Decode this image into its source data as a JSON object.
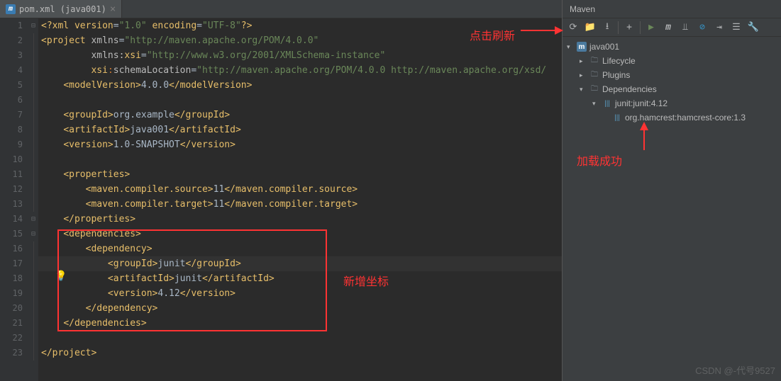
{
  "tab": {
    "icon": "m",
    "label": "pom.xml (java001)"
  },
  "gutter_lines": [
    "1",
    "2",
    "3",
    "4",
    "5",
    "6",
    "7",
    "8",
    "9",
    "10",
    "11",
    "12",
    "13",
    "14",
    "15",
    "16",
    "17",
    "18",
    "19",
    "20",
    "21",
    "22",
    "23"
  ],
  "fold_markers": {
    "1": "⊟",
    "14": "⊟",
    "15": "⊟"
  },
  "code": [
    {
      "seg": [
        {
          "c": "t-decl",
          "t": "<?"
        },
        {
          "c": "t-tag",
          "t": "xml version"
        },
        {
          "c": "t-text",
          "t": "="
        },
        {
          "c": "t-str",
          "t": "\"1.0\""
        },
        {
          "c": "t-tag",
          "t": " encoding"
        },
        {
          "c": "t-text",
          "t": "="
        },
        {
          "c": "t-str",
          "t": "\"UTF-8\""
        },
        {
          "c": "t-decl",
          "t": "?>"
        }
      ]
    },
    {
      "seg": [
        {
          "c": "t-tag",
          "t": "<project "
        },
        {
          "c": "t-attr",
          "t": "xmlns"
        },
        {
          "c": "t-text",
          "t": "="
        },
        {
          "c": "t-str",
          "t": "\"http://maven.apache.org/POM/4.0.0\""
        }
      ]
    },
    {
      "seg": [
        {
          "c": "t-text",
          "t": "         "
        },
        {
          "c": "t-attr",
          "t": "xmlns:"
        },
        {
          "c": "t-tag",
          "t": "xsi"
        },
        {
          "c": "t-text",
          "t": "="
        },
        {
          "c": "t-str",
          "t": "\"http://www.w3.org/2001/XMLSchema-instance\""
        }
      ]
    },
    {
      "seg": [
        {
          "c": "t-text",
          "t": "         "
        },
        {
          "c": "t-tag",
          "t": "xsi"
        },
        {
          "c": "t-sep",
          "t": ":"
        },
        {
          "c": "t-attr",
          "t": "schemaLocation"
        },
        {
          "c": "t-text",
          "t": "="
        },
        {
          "c": "t-str",
          "t": "\"http://maven.apache.org/POM/4.0.0 http://maven.apache.org/xsd/"
        }
      ]
    },
    {
      "seg": [
        {
          "c": "t-text",
          "t": "    "
        },
        {
          "c": "t-tag",
          "t": "<modelVersion>"
        },
        {
          "c": "t-text",
          "t": "4.0.0"
        },
        {
          "c": "t-tag",
          "t": "</modelVersion>"
        }
      ]
    },
    {
      "seg": [
        {
          "c": "t-text",
          "t": ""
        }
      ]
    },
    {
      "seg": [
        {
          "c": "t-text",
          "t": "    "
        },
        {
          "c": "t-tag",
          "t": "<groupId>"
        },
        {
          "c": "t-text",
          "t": "org.example"
        },
        {
          "c": "t-tag",
          "t": "</groupId>"
        }
      ]
    },
    {
      "seg": [
        {
          "c": "t-text",
          "t": "    "
        },
        {
          "c": "t-tag",
          "t": "<artifactId>"
        },
        {
          "c": "t-text",
          "t": "java001"
        },
        {
          "c": "t-tag",
          "t": "</artifactId>"
        }
      ]
    },
    {
      "seg": [
        {
          "c": "t-text",
          "t": "    "
        },
        {
          "c": "t-tag",
          "t": "<version>"
        },
        {
          "c": "t-text",
          "t": "1.0-SNAPSHOT"
        },
        {
          "c": "t-tag",
          "t": "</version>"
        }
      ]
    },
    {
      "seg": [
        {
          "c": "t-text",
          "t": ""
        }
      ]
    },
    {
      "seg": [
        {
          "c": "t-text",
          "t": "    "
        },
        {
          "c": "t-tag",
          "t": "<properties>"
        }
      ]
    },
    {
      "seg": [
        {
          "c": "t-text",
          "t": "        "
        },
        {
          "c": "t-tag",
          "t": "<maven.compiler.source>"
        },
        {
          "c": "t-text",
          "t": "11"
        },
        {
          "c": "t-tag",
          "t": "</maven.compiler.source>"
        }
      ]
    },
    {
      "seg": [
        {
          "c": "t-text",
          "t": "        "
        },
        {
          "c": "t-tag",
          "t": "<maven.compiler.target>"
        },
        {
          "c": "t-text",
          "t": "11"
        },
        {
          "c": "t-tag",
          "t": "</maven.compiler.target>"
        }
      ]
    },
    {
      "seg": [
        {
          "c": "t-text",
          "t": "    "
        },
        {
          "c": "t-tag",
          "t": "</properties>"
        }
      ]
    },
    {
      "seg": [
        {
          "c": "t-text",
          "t": "    "
        },
        {
          "c": "t-tag",
          "t": "<dependencies>"
        }
      ]
    },
    {
      "seg": [
        {
          "c": "t-text",
          "t": "        "
        },
        {
          "c": "t-tag",
          "t": "<dependency>"
        }
      ]
    },
    {
      "seg": [
        {
          "c": "t-text",
          "t": "            "
        },
        {
          "c": "t-tag",
          "t": "<groupId>"
        },
        {
          "c": "t-text",
          "t": "junit"
        },
        {
          "c": "t-tag",
          "t": "</groupId>"
        }
      ],
      "active": true
    },
    {
      "seg": [
        {
          "c": "t-text",
          "t": "            "
        },
        {
          "c": "t-tag",
          "t": "<artifactId>"
        },
        {
          "c": "t-text",
          "t": "junit"
        },
        {
          "c": "t-tag",
          "t": "</artifactId>"
        }
      ]
    },
    {
      "seg": [
        {
          "c": "t-text",
          "t": "            "
        },
        {
          "c": "t-tag",
          "t": "<version>"
        },
        {
          "c": "t-text",
          "t": "4.12"
        },
        {
          "c": "t-tag",
          "t": "</version>"
        }
      ]
    },
    {
      "seg": [
        {
          "c": "t-text",
          "t": "        "
        },
        {
          "c": "t-tag",
          "t": "</dependency>"
        }
      ]
    },
    {
      "seg": [
        {
          "c": "t-text",
          "t": "    "
        },
        {
          "c": "t-tag",
          "t": "</dependencies>"
        }
      ]
    },
    {
      "seg": [
        {
          "c": "t-text",
          "t": ""
        }
      ]
    },
    {
      "seg": [
        {
          "c": "t-tag",
          "t": "</project>"
        }
      ]
    }
  ],
  "annotations": {
    "refresh": "点击刷新",
    "new_coord": "新增坐标",
    "load_success": "加载成功"
  },
  "maven": {
    "title": "Maven",
    "tree": {
      "root": "java001",
      "lifecycle": "Lifecycle",
      "plugins": "Plugins",
      "dependencies": "Dependencies",
      "junit": "junit:junit:4.12",
      "hamcrest": "org.hamcrest:hamcrest-core:1.3"
    }
  },
  "watermark": "CSDN @-代号9527"
}
